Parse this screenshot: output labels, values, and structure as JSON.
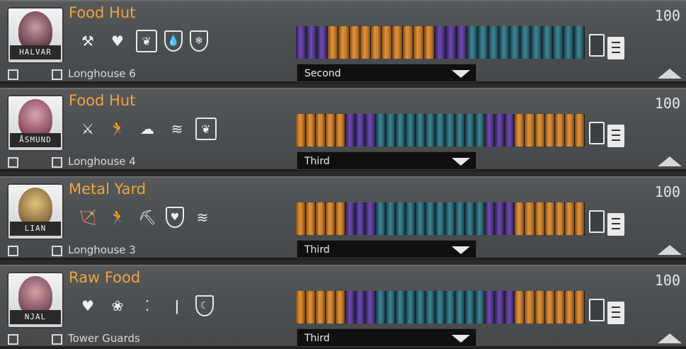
{
  "rows": [
    {
      "name": "HALVAR",
      "job": "Food Hut",
      "home": "Longhouse 6",
      "schedule": "Second",
      "priority": "100",
      "traits": [
        "crossed-tools-icon",
        "heart-icon",
        "plant-box-icon",
        "water-shield-icon",
        "snow-shield-icon"
      ],
      "segments": "pppsssssssssspppttttttttttt"
    },
    {
      "name": "ÅSMUND",
      "job": "Food Hut",
      "home": "Longhouse 4",
      "schedule": "Third",
      "priority": "100",
      "traits": [
        "axe-icon",
        "running-icon",
        "storm-cloud-icon",
        "wind-icon",
        "plant-box-icon"
      ],
      "segments": "sssssppptttttttttttpppsssssss"
    },
    {
      "name": "LIAN",
      "job": "Metal Yard",
      "home": "Longhouse 3",
      "schedule": "Third",
      "priority": "100",
      "traits": [
        "bow-icon",
        "running-icon",
        "pickaxe-icon",
        "heart-shield-icon",
        "wind-icon"
      ],
      "segments": "sssssppptttttttttttpppsssssss"
    },
    {
      "name": "NJAL",
      "job": "Raw Food",
      "home": "Tower Guards",
      "schedule": "Third",
      "priority": "100",
      "traits": [
        "heart-icon",
        "lotus-icon",
        "footprints-icon",
        "figure-icon",
        "moon-shield-icon"
      ],
      "segments": "sssssppptttttttttttpppsssssss"
    }
  ]
}
